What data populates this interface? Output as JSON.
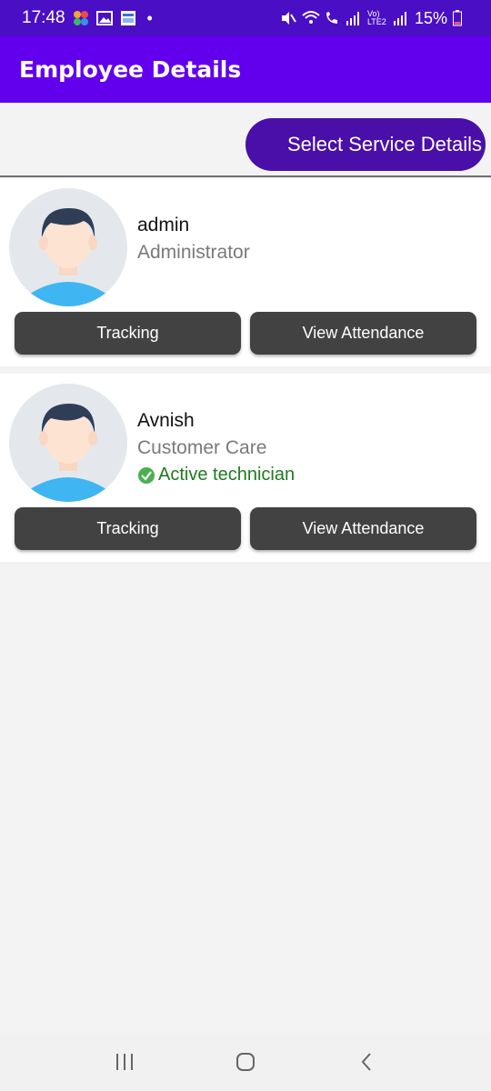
{
  "status_bar": {
    "time": "17:48",
    "battery": "15%",
    "network_label": "Vo) LTE2"
  },
  "appbar": {
    "title": "Employee Details"
  },
  "service": {
    "button_label": "Select Service Details"
  },
  "employees": [
    {
      "name": "admin",
      "role": "Administrator",
      "status": "",
      "tracking_label": "Tracking",
      "attendance_label": "View Attendance"
    },
    {
      "name": "Avnish",
      "role": "Customer Care",
      "status": "Active technician",
      "tracking_label": "Tracking",
      "attendance_label": "View Attendance"
    }
  ],
  "colors": {
    "status_bar": "#4a0fc4",
    "appbar": "#6200ee",
    "service_button": "#4a0fa8",
    "card_button": "#424242",
    "active_status": "#1f7a1f"
  },
  "icons": {
    "status_left": [
      "app-pinwheel-icon",
      "gallery-icon",
      "app-icon"
    ],
    "status_right": [
      "mute-icon",
      "wifi-icon",
      "call-icon",
      "signal-icon",
      "signal-icon",
      "battery-icon"
    ],
    "nav": [
      "recents-icon",
      "home-icon",
      "back-icon"
    ]
  }
}
